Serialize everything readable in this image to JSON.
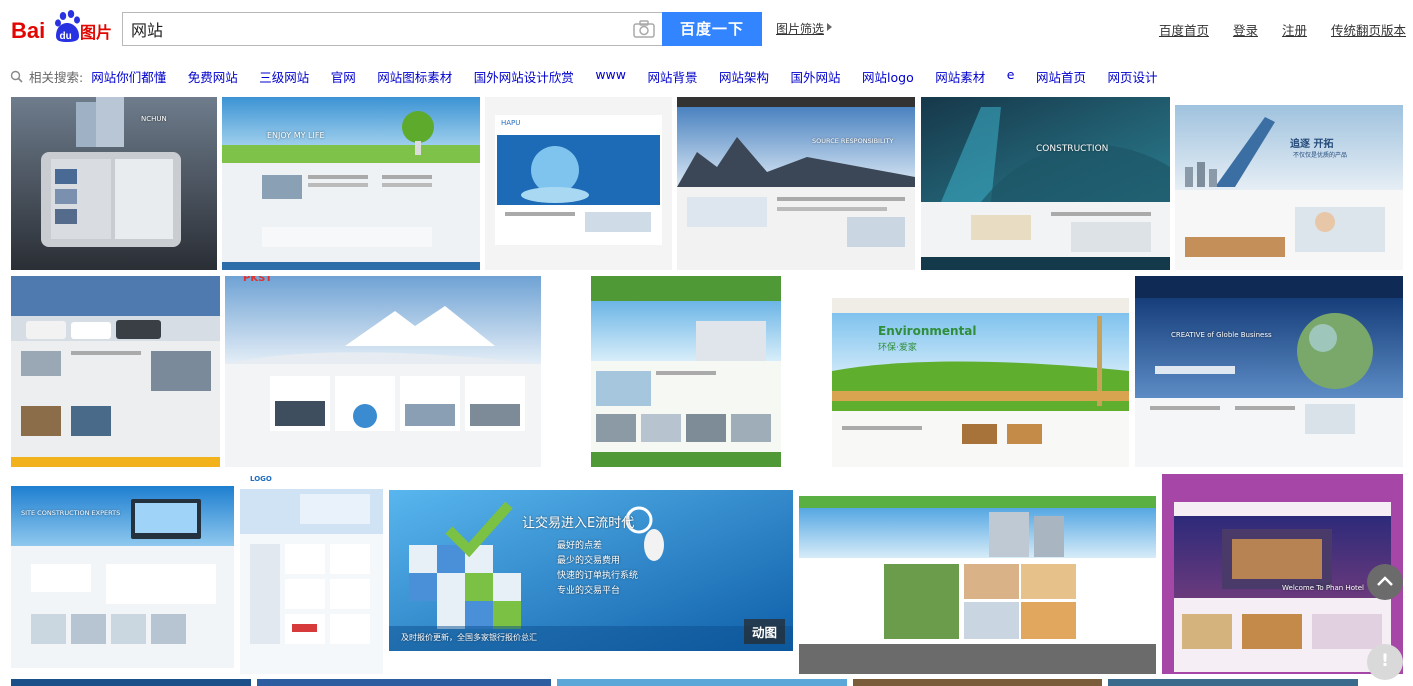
{
  "logo": {
    "text_bai": "Bai",
    "text_du": "du",
    "text_img": "图片"
  },
  "search": {
    "value": "网站",
    "button_label": "百度一下"
  },
  "filter": {
    "label": "图片筛选"
  },
  "top_links": [
    "百度首页",
    "登录",
    "注册",
    "传统翻页版本"
  ],
  "related": {
    "label": "相关搜索:",
    "items": [
      "网站你们都懂",
      "免费网站",
      "三级网站",
      "官网",
      "网站图标素材",
      "国外网站设计欣赏",
      "www",
      "网站背景",
      "网站架构",
      "国外网站",
      "网站logo",
      "网站素材",
      "e",
      "网站首页",
      "网页设计"
    ]
  },
  "thumbnails": {
    "t1": "NCHUN",
    "t2": "ENJOY MY LIFE",
    "t3": "HAPU",
    "t4": "SOURCE RESPONSIBILITY",
    "t5": "CONSTRUCTION",
    "t6_a": "追逐 开拓",
    "t6_b": "不仅仅是优质的产品",
    "t8": "PKST",
    "t10_a": "Environmental",
    "t10_b": "环保·爱家",
    "t11": "CREATIVE of Globle Business",
    "t12": "SITE CONSTRUCTION EXPERTS",
    "t13": "LOGO",
    "t14_a": "让交易进入E流时代",
    "t14_b": "最好的点差",
    "t14_c": "最少的交易费用",
    "t14_d": "快速的订单执行系统",
    "t14_e": "专业的交易平台",
    "t14_f": "及时报价更新，全国多家银行报价总汇",
    "t14_overlay": "动图",
    "t16": "Welcome To Phan Hotel"
  },
  "feedback": {
    "symbol": "!"
  },
  "colors": {
    "accent": "#3385ff",
    "link": "#0000cc",
    "logo_red": "#e10601",
    "logo_blue": "#2932e1"
  }
}
